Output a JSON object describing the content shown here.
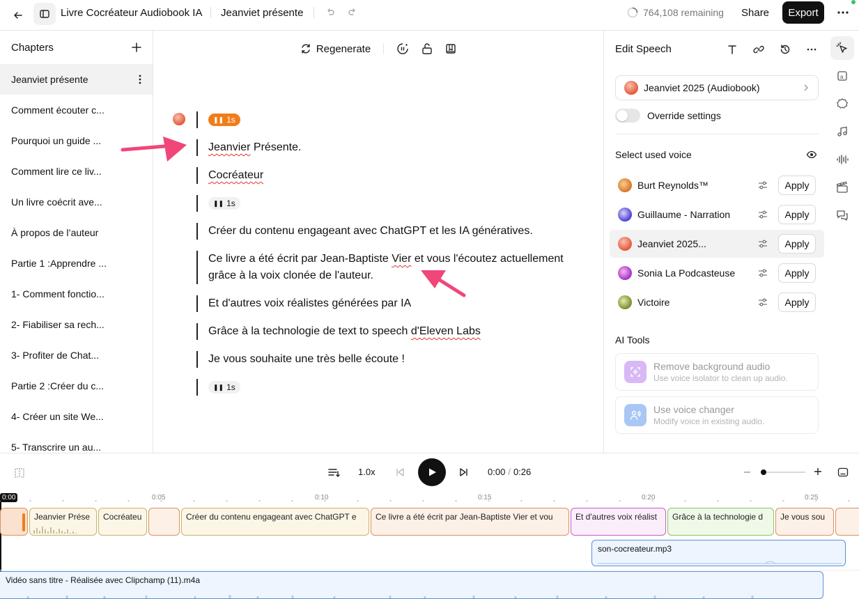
{
  "topbar": {
    "project_title": "Livre Cocréateur Audiobook IA",
    "chapter_title": "Jeanviet présente",
    "remaining": "764,108 remaining",
    "share_label": "Share",
    "export_label": "Export"
  },
  "sidebar": {
    "title": "Chapters",
    "chapters": [
      "Jeanviet présente",
      "Comment écouter c...",
      "Pourquoi un guide ...",
      "Comment lire ce liv...",
      "Un livre coécrit ave...",
      "À propos de l’auteur",
      "Partie 1 :Apprendre ...",
      "1- Comment fonctio...",
      "2- Fiabiliser sa rech...",
      "3- Profiter de Chat...",
      "Partie 2 :Créer du c...",
      "4- Créer un site We...",
      "5- Transcrire un au..."
    ]
  },
  "editor": {
    "regenerate_label": "Regenerate",
    "pause1": "1s",
    "line1_a": "Jeanvier",
    "line1_b": " Présente.",
    "line2": "Cocréateur",
    "pause2": "1s",
    "line3": "Créer du contenu engageant avec ChatGPT et les IA génératives.",
    "line4_a": "Ce livre a été écrit par Jean-Baptiste ",
    "line4_b": "Vier",
    "line4_c": " et vous l'écoutez actuellement",
    "line4_d": "grâce à la voix clonée de l'auteur.",
    "line5": "Et d'autres voix réalistes générées par IA",
    "line6_a": "Grâce à la technologie de text to speech ",
    "line6_b": "d'Eleven Labs",
    "line7": "Je vous souhaite une très belle écoute !",
    "pause3": "1s"
  },
  "panel": {
    "title": "Edit Speech",
    "voice_name": "Jeanviet 2025 (Audiobook)",
    "override_label": "Override settings",
    "select_voice_label": "Select used voice",
    "apply_label": "Apply",
    "voices": [
      {
        "name": "Burt Reynolds™"
      },
      {
        "name": "Guillaume - Narration"
      },
      {
        "name": "Jeanviet 2025..."
      },
      {
        "name": "Sonia La Podcasteuse"
      },
      {
        "name": "Victoire"
      }
    ],
    "ai_tools_label": "AI Tools",
    "tools": [
      {
        "title": "Remove background audio",
        "desc": "Use voice isolator to clean up audio."
      },
      {
        "title": "Use voice changer",
        "desc": "Modify voice in existing audio."
      }
    ]
  },
  "player": {
    "speed": "1.0x",
    "time_current": "0:00",
    "time_sep": "/",
    "time_total": "0:26"
  },
  "timeline": {
    "playhead": "0:00",
    "ticks": [
      "0:05",
      "0:10",
      "0:15",
      "0:20",
      "0:25"
    ],
    "clips": [
      "Jeanvier Prése",
      "Cocréateu",
      "",
      "Créer du contenu engageant avec ChatGPT e",
      "Ce livre a été écrit par Jean-Baptiste Vier et vou",
      "Et d'autres voix réalist",
      "Grâce à la technologie d",
      "Je vous sou"
    ],
    "audio_track_1": "son-cocreateur.mp3",
    "audio_track_2": "Vidéo sans titre - Réalisée avec Clipchamp (11).m4a"
  }
}
